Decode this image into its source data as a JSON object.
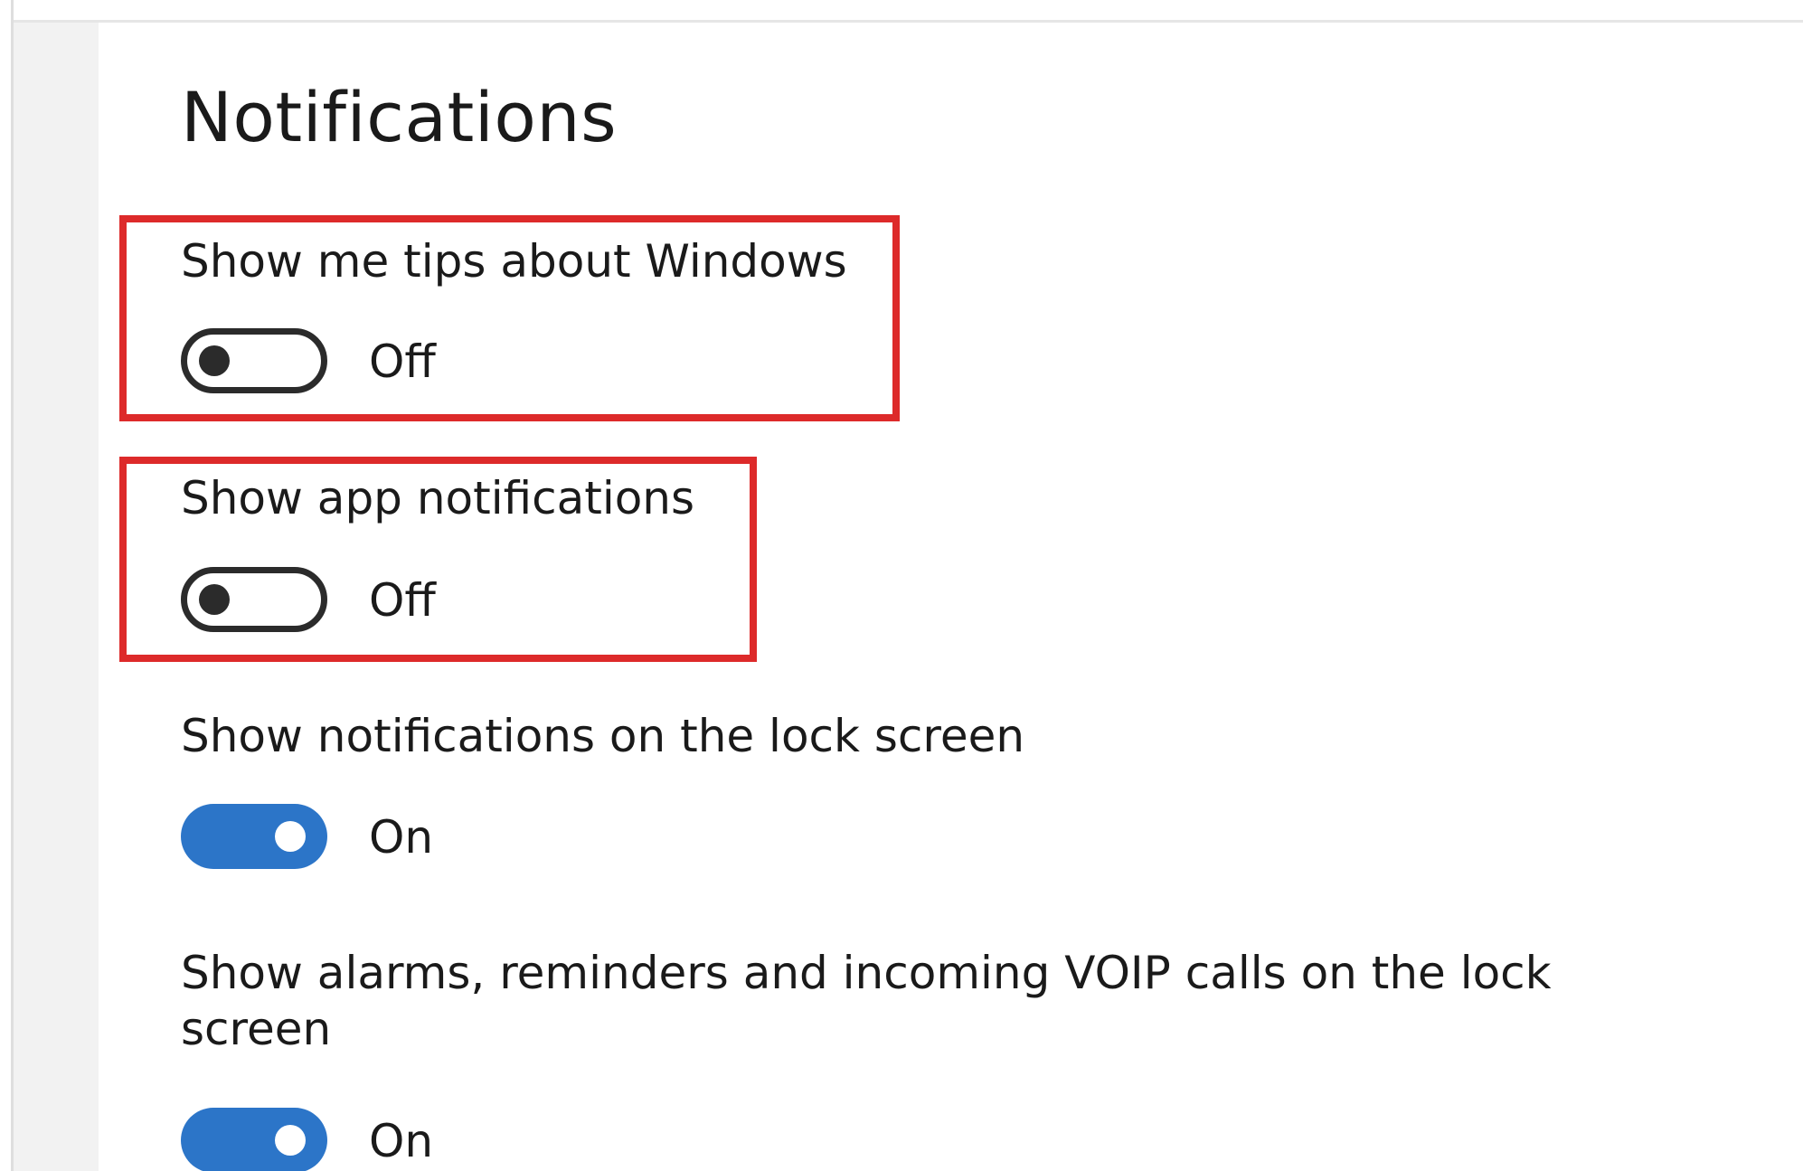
{
  "page": {
    "title": "Notifications"
  },
  "settings": [
    {
      "label": "Show me tips about Windows",
      "state": "Off",
      "on": false,
      "highlighted": true
    },
    {
      "label": "Show app notifications",
      "state": "Off",
      "on": false,
      "highlighted": true
    },
    {
      "label": "Show notifications on the lock screen",
      "state": "On",
      "on": true,
      "highlighted": false
    },
    {
      "label": "Show alarms, reminders and incoming VOIP calls on the lock screen",
      "state": "On",
      "on": true,
      "highlighted": false
    }
  ],
  "colors": {
    "accent": "#2c75c8",
    "highlight": "#dd2a2a",
    "toggle_off": "#2b2b2b"
  }
}
